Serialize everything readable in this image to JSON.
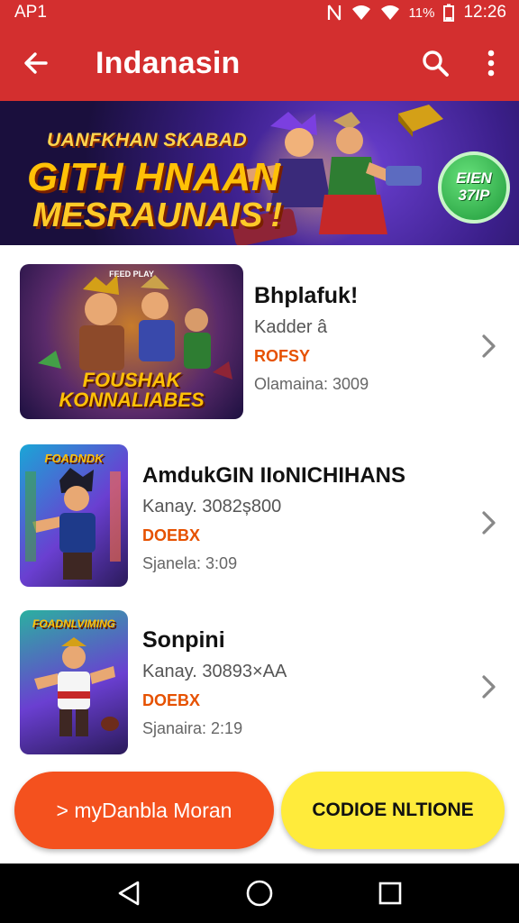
{
  "status_bar": {
    "left_text": "AP1",
    "battery": "11%",
    "time": "12:26",
    "icons": [
      "nfc-icon",
      "wifi-icon",
      "signal-icon",
      "battery-icon"
    ]
  },
  "app_bar": {
    "title": "Indanasin",
    "icons": [
      "back-arrow-icon",
      "search-icon",
      "more-vert-icon"
    ]
  },
  "banner": {
    "line1": "UANFKHAN SKABAD",
    "line2": "GITH HNAAN",
    "line3": "MESRAUNAIS'!",
    "badge_line1": "EIEN",
    "badge_line2": "37IP"
  },
  "items": [
    {
      "thumb_tag": "FEED PLAY",
      "thumb_title": "FOUSHAK KONNALIABES",
      "name": "Bhplafuk!",
      "subtitle": "Kadder â",
      "price": "ROFSY",
      "meta": "Olamaina: 3009"
    },
    {
      "thumb_tag": "",
      "thumb_title": "FOADNDK",
      "name": "AmdukGIN IIoNICHIHANS",
      "subtitle": "Kanay. 3082ș800",
      "price": "DOEBX",
      "meta": "Sjanela: 3:09"
    },
    {
      "thumb_tag": "",
      "thumb_title": "FOADNLVIMING",
      "name": "Sonpini",
      "subtitle": "Kanay. 30893×AA",
      "price": "DOEBX",
      "meta": "Sjanaira: 2:19"
    }
  ],
  "buttons": {
    "primary_label": "> myDanbla Moran",
    "secondary_label": "CODIOE NLTIONE"
  },
  "nav_bar": {
    "icons": [
      "back-triangle-icon",
      "home-circle-icon",
      "recents-square-icon"
    ]
  },
  "colors": {
    "app_bar": "#d32f2f",
    "primary_button": "#f4511e",
    "secondary_button": "#ffeb3b",
    "price": "#e65100"
  }
}
